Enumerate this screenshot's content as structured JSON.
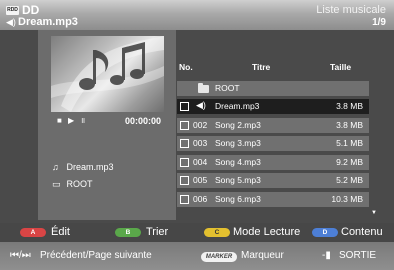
{
  "header": {
    "device_icon_text": "RDD",
    "device": "DD",
    "screen_title": "Liste musicale",
    "current_file": "Dream.mp3",
    "page": "1/9"
  },
  "preview": {
    "time": "00:00:00",
    "file": "Dream.mp3",
    "folder": "ROOT",
    "icons": [
      "stop-icon",
      "play-icon",
      "pause-icon"
    ]
  },
  "table": {
    "headers": {
      "no": "No.",
      "title": "Titre",
      "size": "Taille"
    },
    "root": {
      "title": "ROOT"
    },
    "rows": [
      {
        "no": "",
        "title": "Dream.mp3",
        "size": "3.8 MB",
        "selected": true
      },
      {
        "no": "002",
        "title": "Song 2.mp3",
        "size": "3.8 MB"
      },
      {
        "no": "003",
        "title": "Song 3.mp3",
        "size": "5.1 MB"
      },
      {
        "no": "004",
        "title": "Song 4.mp3",
        "size": "9.2 MB"
      },
      {
        "no": "005",
        "title": "Song 5.mp3",
        "size": "5.2 MB"
      },
      {
        "no": "006",
        "title": "Song 6.mp3",
        "size": "10.3 MB"
      }
    ]
  },
  "actions": [
    {
      "key": "A",
      "label": "Édit",
      "color": "#d94545"
    },
    {
      "key": "B",
      "label": "Trier",
      "color": "#5aa84a"
    },
    {
      "key": "C",
      "label": "Mode Lecture",
      "color": "#e3c02f"
    },
    {
      "key": "D",
      "label": "Contenu",
      "color": "#4d7fd6"
    }
  ],
  "nav": {
    "prev_next": "Précédent/Page suivante",
    "marker_key": "MARKER",
    "marker_label": "Marqueur",
    "exit": "SORTIE"
  },
  "colors": {
    "selected_row": "#1e1e1e",
    "row_bg": "#707070",
    "header_bg": "#9a9a9a"
  }
}
